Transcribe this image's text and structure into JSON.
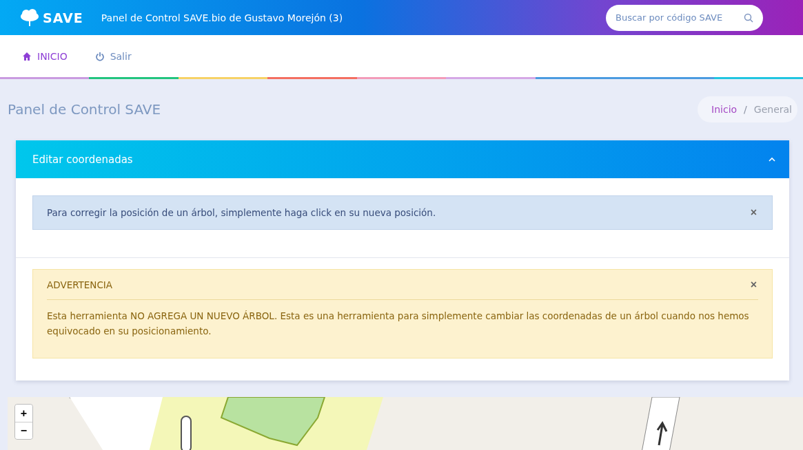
{
  "header": {
    "logo_text": "SAVE",
    "title": "Panel de Control SAVE.bio de Gustavo Morejón (3)",
    "search": {
      "placeholder": "Buscar por código SAVE"
    }
  },
  "nav": [
    {
      "label": "INICIO",
      "kind": "home",
      "selected": true
    },
    {
      "label": "Salir",
      "kind": "power",
      "selected": false
    }
  ],
  "page_title": "Panel de Control SAVE",
  "breadcrumb_separator": "/",
  "breadcrumb": [
    {
      "label": "Inicio",
      "selected": false
    },
    {
      "label": "General",
      "selected": true
    }
  ],
  "card": {
    "title": "Editar coordenadas",
    "expanded": true,
    "alerts": [
      {
        "kind": "info",
        "text": "Para corregir la posición de un árbol, simplemente haga click en su nueva posición.",
        "close": "×"
      },
      {
        "kind": "warning",
        "heading": "ADVERTENCIA",
        "text": "Esta herramienta NO AGREGA UN NUEVO ÁRBOL. Esta es una herramienta para simplemente cambiar las coordenadas de un árbol cuando nos hemos equivocado en su posicionamiento.",
        "close": "×"
      }
    ]
  },
  "map": {
    "zoom_buttons": [
      "+",
      "−"
    ]
  }
}
